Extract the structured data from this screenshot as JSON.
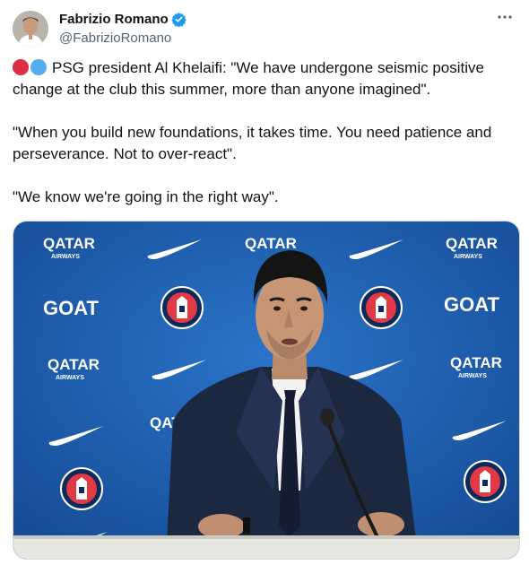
{
  "author": {
    "name": "Fabrizio Romano",
    "handle": "@FabrizioRomano",
    "verified": true
  },
  "more_icon": "more-horizontal-icon",
  "tweet": {
    "emoji": [
      "red-circle",
      "blue-circle"
    ],
    "paragraphs": [
      "PSG president Al Khelaifi: \"We have undergone seismic positive change at the club this summer, more than anyone imagined\".",
      "\"When you build new foundations, it takes time. You need patience and perseverance. Not to over-react\".",
      "\"We know we're going in the right way\"."
    ]
  },
  "media": {
    "backdrop_labels": {
      "qatar": "QATAR",
      "airways": "AIRWAYS",
      "goat": "GOAT"
    }
  },
  "colors": {
    "verified": "#1d9bf0",
    "backdrop": "#1d5fb6",
    "text_secondary": "#536471"
  }
}
